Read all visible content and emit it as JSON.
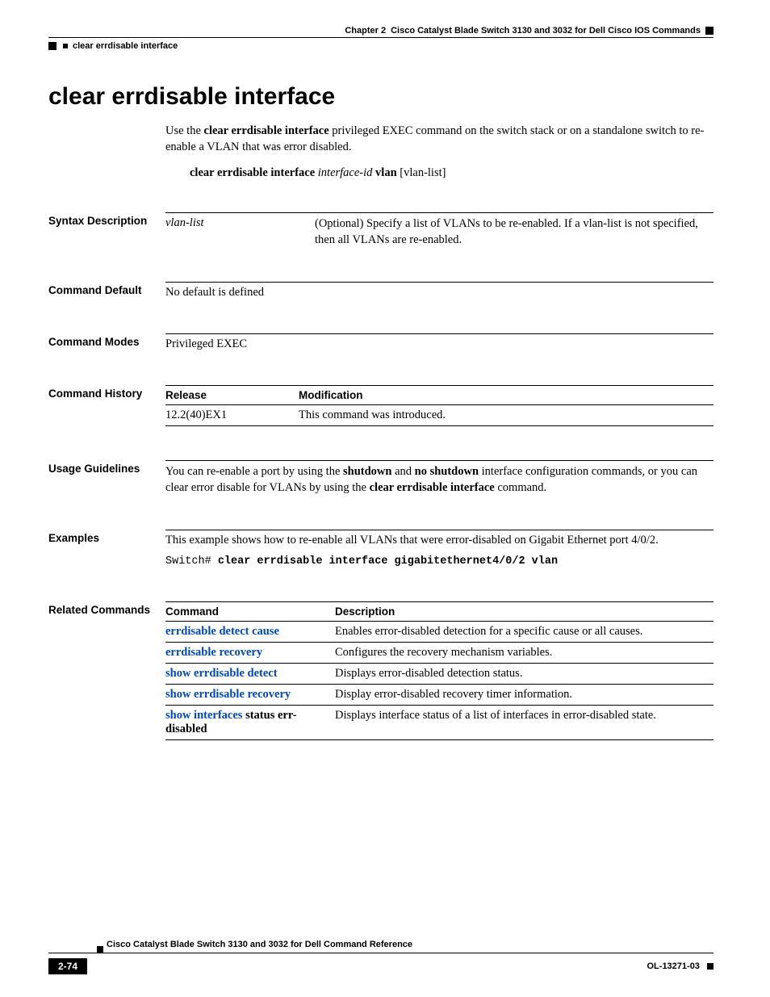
{
  "header": {
    "chapter_label": "Chapter 2",
    "chapter_title": "Cisco Catalyst Blade Switch 3130 and 3032 for Dell Cisco IOS Commands",
    "running_head": "clear errdisable interface"
  },
  "title": "clear errdisable interface",
  "intro": {
    "prefix": "Use the ",
    "cmd": "clear errdisable interface",
    "rest": " privileged EXEC command on the switch stack or on a standalone switch to re-enable a VLAN that was error disabled."
  },
  "syntax_line": {
    "cmd1": "clear errdisable interface ",
    "arg1": "interface-id",
    "cmd2": " vlan ",
    "arg2": "[vlan-list]"
  },
  "syntax_desc": {
    "label": "Syntax Description",
    "param": "vlan-list",
    "desc": "(Optional) Specify a list of VLANs to be re-enabled. If a vlan-list is not specified, then all VLANs are re-enabled."
  },
  "command_default": {
    "label": "Command Default",
    "body": "No default is defined"
  },
  "command_modes": {
    "label": "Command Modes",
    "body": "Privileged EXEC"
  },
  "command_history": {
    "label": "Command History",
    "headers": {
      "release": "Release",
      "modification": "Modification"
    },
    "rows": [
      {
        "release": "12.2(40)EX1",
        "modification": "This command was introduced."
      }
    ]
  },
  "usage": {
    "label": "Usage Guidelines",
    "p1a": "You can re-enable a port by using the ",
    "b1": "shutdown",
    "p1b": " and ",
    "b2": "no shutdown",
    "p1c": " interface configuration commands, or you can clear error disable for VLANs by using the ",
    "b3": "clear errdisable interface",
    "p1d": " command."
  },
  "examples": {
    "label": "Examples",
    "intro": "This example shows how to re-enable all VLANs that were error-disabled on Gigabit Ethernet port 4/0/2.",
    "prompt": "Switch# ",
    "cmd": "clear errdisable interface gigabitethernet4/0/2 vlan"
  },
  "related": {
    "label": "Related Commands",
    "headers": {
      "command": "Command",
      "description": "Description"
    },
    "rows": [
      {
        "cmd": "errdisable detect cause",
        "suffix": "",
        "desc": "Enables error-disabled detection for a specific cause or all causes."
      },
      {
        "cmd": "errdisable recovery",
        "suffix": "",
        "desc": "Configures the recovery mechanism variables."
      },
      {
        "cmd": "show errdisable detect",
        "suffix": "",
        "desc": "Displays error-disabled detection status."
      },
      {
        "cmd": "show errdisable recovery",
        "suffix": "",
        "desc": "Display error-disabled recovery timer information."
      },
      {
        "cmd": "show interfaces",
        "suffix": " status err-disabled",
        "desc": "Displays interface status of a list of interfaces in error-disabled state."
      }
    ]
  },
  "footer": {
    "book": "Cisco Catalyst Blade Switch 3130 and 3032 for Dell Command Reference",
    "page": "2-74",
    "docid": "OL-13271-03"
  }
}
